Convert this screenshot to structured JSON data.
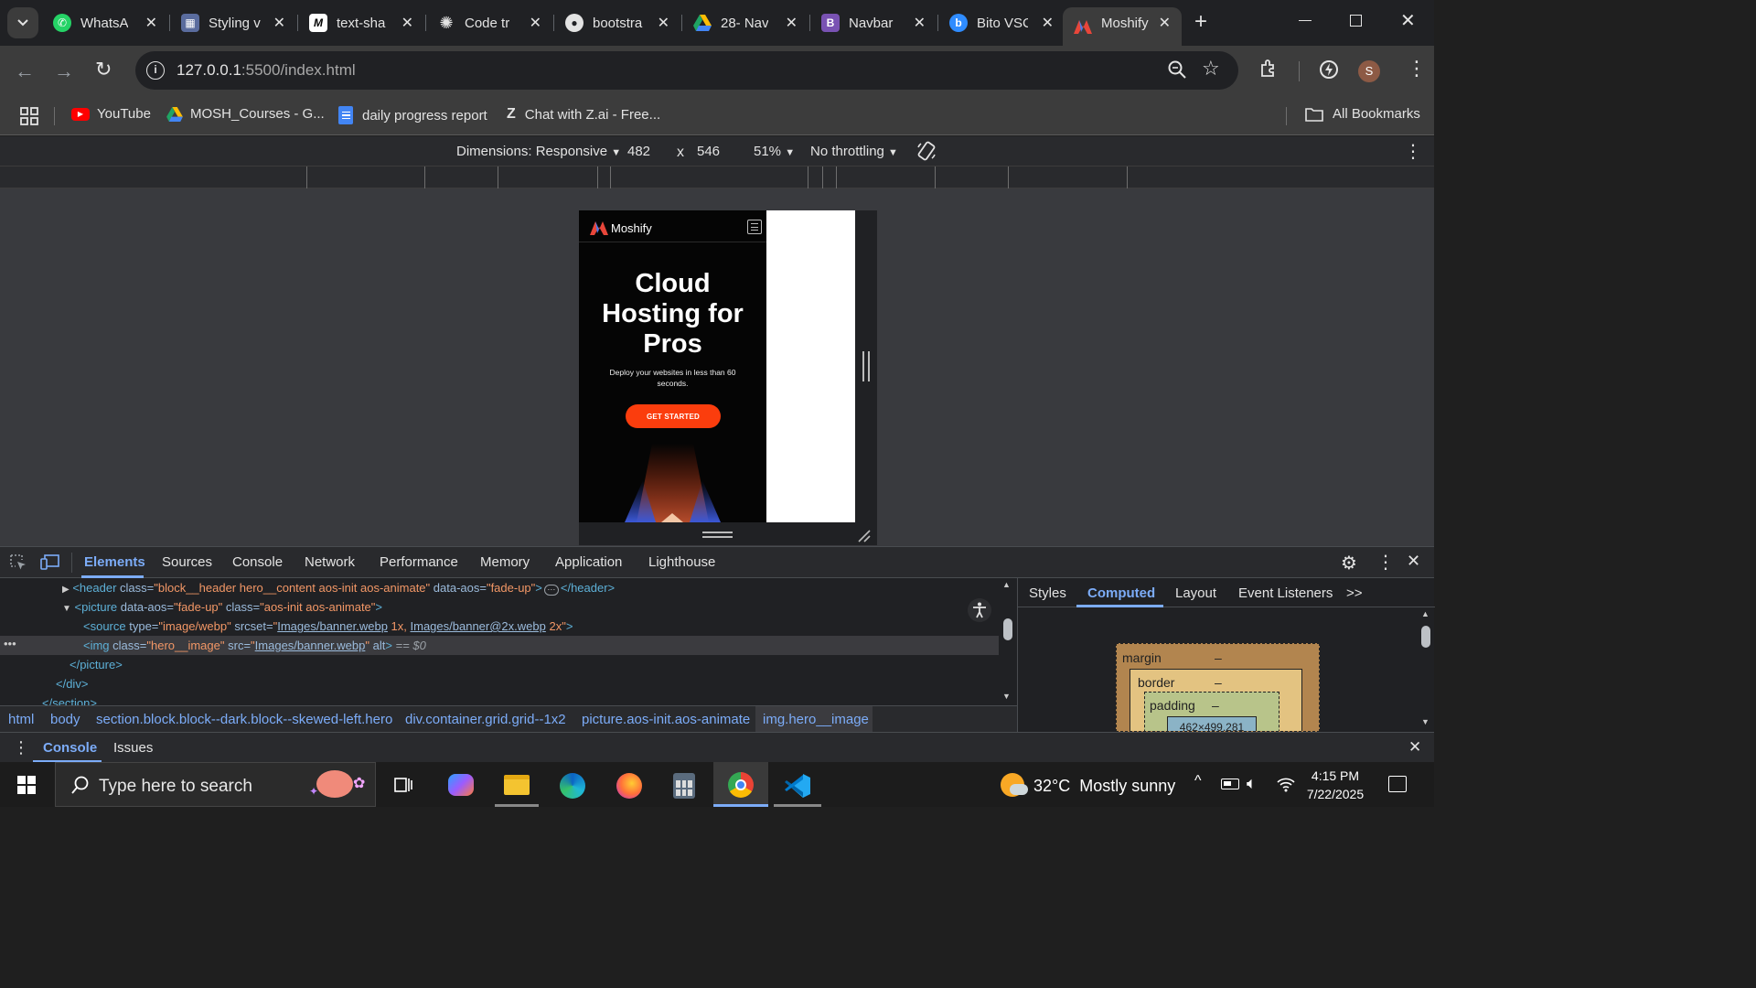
{
  "tabs": [
    {
      "title": "WhatsApp",
      "icon": "whatsapp-icon"
    },
    {
      "title": "Styling v",
      "icon": "styling-icon"
    },
    {
      "title": "text-sha",
      "icon": "m-logo-icon"
    },
    {
      "title": "Code tr",
      "icon": "openai-icon"
    },
    {
      "title": "bootstra",
      "icon": "github-icon"
    },
    {
      "title": "28- Nav",
      "icon": "google-drive-icon"
    },
    {
      "title": "Navbar",
      "icon": "bootstrap-icon"
    },
    {
      "title": "Bito VSC",
      "icon": "bito-icon"
    },
    {
      "title": "Moshify",
      "icon": "moshify-icon"
    }
  ],
  "address": {
    "host": "127.0.0.1",
    "rest": ":5500/index.html"
  },
  "bookmarks": [
    {
      "label": "YouTube"
    },
    {
      "label": "MOSH_Courses - G..."
    },
    {
      "label": "daily progress report"
    },
    {
      "label": "Chat with Z.ai - Free..."
    }
  ],
  "all_bookmarks": "All Bookmarks",
  "profile_initial": "S",
  "device_toolbar": {
    "dimensions": "Dimensions: Responsive",
    "width": "482",
    "times": "x",
    "height": "546",
    "zoom": "51%",
    "throttling": "No throttling"
  },
  "mobile": {
    "brand": "Moshify",
    "title_lines": [
      "Cloud",
      "Hosting for",
      "Pros"
    ],
    "subtitle_lines": [
      "Deploy your websites in less than 60",
      "seconds."
    ],
    "cta": "GET STARTED"
  },
  "devtools_tabs": [
    "Elements",
    "Sources",
    "Console",
    "Network",
    "Performance",
    "Memory",
    "Application",
    "Lighthouse"
  ],
  "dom": {
    "l1": {
      "open": "<header ",
      "a1": "class=",
      "v1": "\"block__header hero__content aos-init aos-animate\"",
      "a2": " data-aos=",
      "v2": "\"fade-up\"",
      "close": "></header>"
    },
    "l2": {
      "open": "<picture ",
      "a1": "data-aos=",
      "v1": "\"fade-up\"",
      "a2": " class=",
      "v2": "\"aos-init aos-animate\"",
      "close": ">"
    },
    "l3": {
      "open": "<source ",
      "a1": "type=",
      "v1": "\"image/webp\"",
      "a2": " srcset=",
      "q": "\"",
      "link1": "Images/banner.webp",
      "mid": " 1x, ",
      "link2": "Images/banner@2x.webp",
      "end": " 2x\"",
      "close": ">"
    },
    "l4": {
      "open": "<img ",
      "a1": "class=",
      "v1": "\"hero__image\"",
      "a2": " src=",
      "q": "\"",
      "link": "Images/banner.webp",
      "q2": "\"",
      "a3": " alt",
      "close": ">",
      "eq": " == $0"
    },
    "l5": "</picture>",
    "l6": "</div>",
    "l7": "</section>"
  },
  "breadcrumbs": [
    "html",
    "body",
    "section.block.block--dark.block--skewed-left.hero",
    "div.container.grid.grid--1x2",
    "picture.aos-init.aos-animate",
    "img.hero__image"
  ],
  "side_tabs": [
    "Styles",
    "Computed",
    "Layout",
    "Event Listeners",
    ">>"
  ],
  "box_model": {
    "margin": "margin",
    "border": "border",
    "padding": "padding",
    "dash": "–",
    "content": "462×499.281"
  },
  "console_tabs": [
    "Console",
    "Issues"
  ],
  "taskbar": {
    "search": "Type here to search",
    "weather": "32°C  Mostly sunny",
    "time": "4:15 PM",
    "date": "7/22/2025"
  },
  "colors": {
    "accent": "#fb3d0d",
    "devtools_active": "#7cacf8"
  }
}
